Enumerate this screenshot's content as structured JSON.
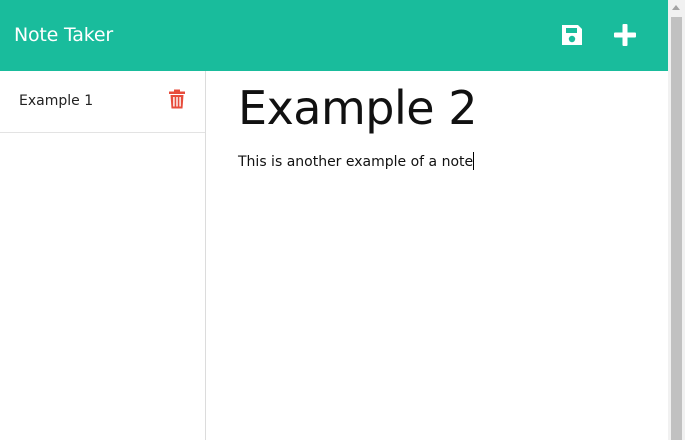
{
  "navbar": {
    "brand": "Note Taker",
    "save_icon": "save-icon",
    "add_icon": "plus-icon"
  },
  "sidebar": {
    "notes": [
      {
        "title": "Example 1",
        "delete_icon": "trash-icon"
      }
    ]
  },
  "editor": {
    "title": "Example 2",
    "text": "This is another example of a note"
  },
  "colors": {
    "accent": "#19bc9c",
    "delete": "#e74c3c"
  }
}
